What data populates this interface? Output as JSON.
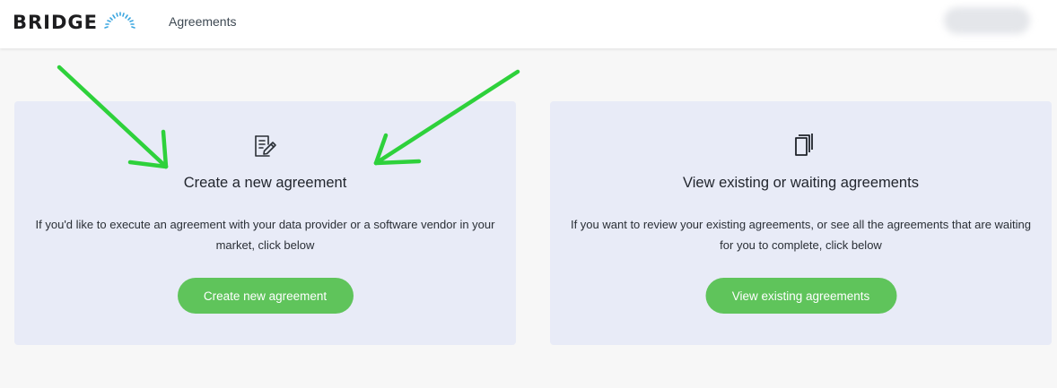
{
  "header": {
    "logo_text": "BRIDGE",
    "nav_label": "Agreements"
  },
  "cards": {
    "create": {
      "icon": "edit-document-icon",
      "title": "Create a new agreement",
      "description": "If you'd like to execute an agreement with your data provider or a software vendor in your market, click below",
      "button_label": "Create new agreement"
    },
    "view": {
      "icon": "documents-stack-icon",
      "title": "View existing or waiting agreements",
      "description": "If you want to review your existing agreements, or see all the agreements that are waiting for you to complete, click below",
      "button_label": "View existing agreements"
    }
  },
  "annotations": {
    "arrow_color": "#2ed13b"
  },
  "colors": {
    "accent_green": "#5fc45b",
    "card_background": "#e8ebf7",
    "logo_arc": "#3aa6e0"
  }
}
